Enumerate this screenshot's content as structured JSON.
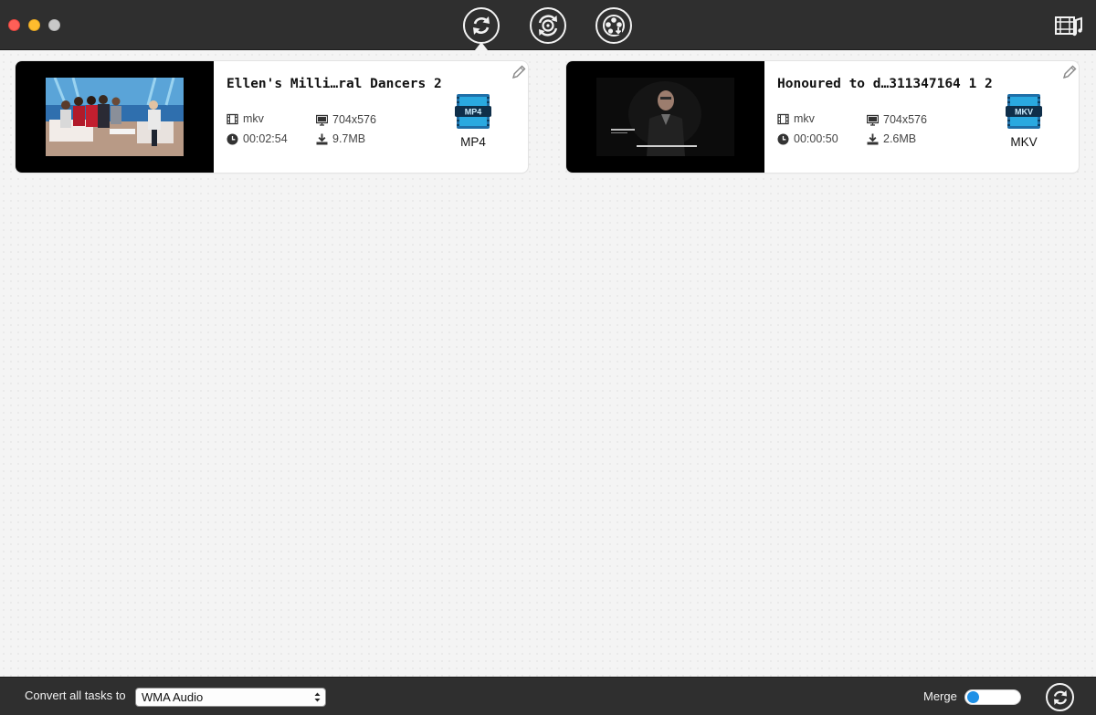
{
  "window": {
    "controls": [
      "close",
      "minimize",
      "zoom"
    ]
  },
  "toolbar": {
    "buttons": [
      {
        "id": "convert",
        "icon": "convert-arrows-icon",
        "active": true
      },
      {
        "id": "rip",
        "icon": "disc-rotate-icon",
        "active": false
      },
      {
        "id": "download",
        "icon": "film-reel-download-icon",
        "active": false
      }
    ],
    "media_browser_icon": "media-browser-icon"
  },
  "tasks": [
    {
      "title": "Ellen's Milli…ral Dancers 2",
      "format": "mkv",
      "resolution": "704x576",
      "duration": "00:02:54",
      "size": "9.7MB",
      "output_badge": "MP4",
      "output_label": "MP4",
      "thumbnail": "talk-show-stage-frame"
    },
    {
      "title": "Honoured to d…311347164 1 2",
      "format": "mkv",
      "resolution": "704x576",
      "duration": "00:00:50",
      "size": "2.6MB",
      "output_badge": "MKV",
      "output_label": "MKV",
      "thumbnail": "dark-interview-frame"
    }
  ],
  "bottombar": {
    "convert_label": "Convert all tasks to",
    "target_format": "WMA Audio",
    "merge_label": "Merge",
    "merge_enabled": false
  },
  "colors": {
    "accent_blue": "#1e90e6",
    "badge_blue": "#2aa9e0",
    "chrome_dark": "#2f2f2f"
  }
}
